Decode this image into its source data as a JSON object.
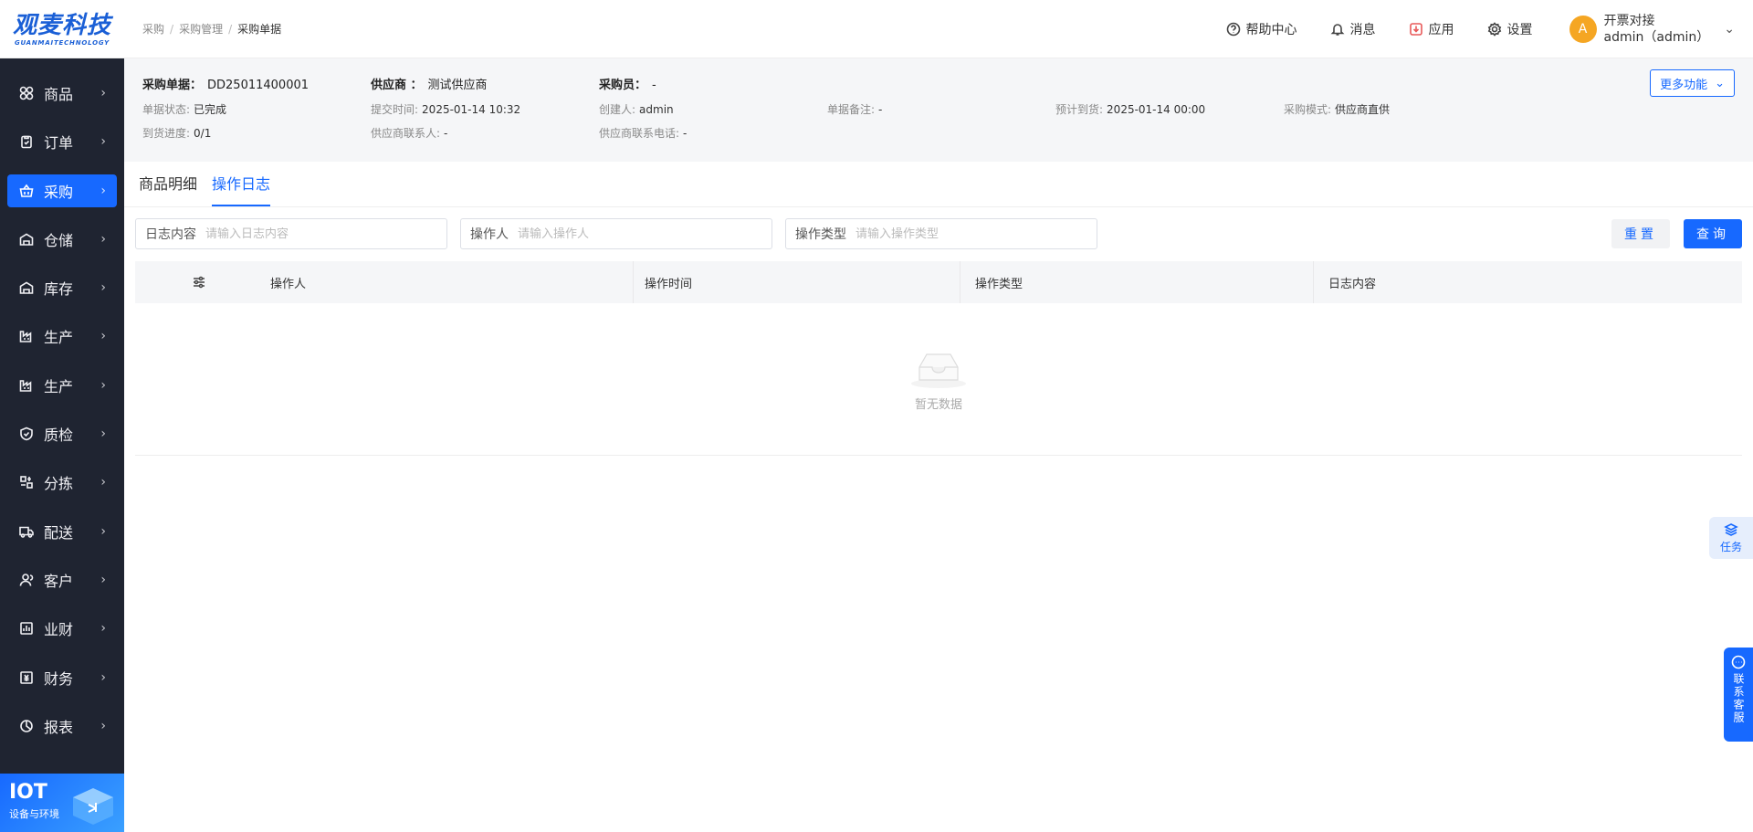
{
  "brand": {
    "cn": "观麦科技",
    "en": "GUANMAITECHNOLOGY",
    "color": "#1a5fd6"
  },
  "sidebar": {
    "items": [
      {
        "label": "商品",
        "icon": "grid-icon"
      },
      {
        "label": "订单",
        "icon": "clipboard-icon"
      },
      {
        "label": "采购",
        "icon": "basket-icon",
        "active": true
      },
      {
        "label": "仓储",
        "icon": "warehouse-icon"
      },
      {
        "label": "库存",
        "icon": "warehouse-icon"
      },
      {
        "label": "生产",
        "icon": "factory-icon"
      },
      {
        "label": "生产",
        "icon": "factory-icon"
      },
      {
        "label": "质检",
        "icon": "shield-icon"
      },
      {
        "label": "分拣",
        "icon": "sort-icon"
      },
      {
        "label": "配送",
        "icon": "truck-icon"
      },
      {
        "label": "客户",
        "icon": "user-icon"
      },
      {
        "label": "业财",
        "icon": "chart-icon"
      },
      {
        "label": "财务",
        "icon": "finance-icon"
      },
      {
        "label": "报表",
        "icon": "pie-icon"
      }
    ],
    "iot": {
      "title": "IOT",
      "subtitle": "设备与环境"
    }
  },
  "topbar": {
    "breadcrumb": [
      "采购",
      "采购管理",
      "采购单据"
    ],
    "actions": {
      "help": "帮助中心",
      "messages": "消息",
      "apps": "应用",
      "settings": "设置"
    },
    "user": {
      "avatar": "A",
      "company": "开票对接",
      "account": "admin（admin）"
    }
  },
  "info": {
    "order_no_label": "采购单据：",
    "order_no": "DD25011400001",
    "supplier_label": "供应商 ：",
    "supplier": "测试供应商",
    "buyer_label": "采购员：",
    "buyer": "-",
    "status_label": "单据状态:",
    "status": "已完成",
    "submit_time_label": "提交时间:",
    "submit_time": "2025-01-14 10:32",
    "creator_label": "创建人:",
    "creator": "admin",
    "remark_label": "单据备注:",
    "remark": "-",
    "eta_label": "预计到货:",
    "eta": "2025-01-14 00:00",
    "mode_label": "采购模式:",
    "mode": "供应商直供",
    "progress_label": "到货进度:",
    "progress": "0/1",
    "contact_label": "供应商联系人:",
    "contact": "-",
    "phone_label": "供应商联系电话:",
    "phone": "-",
    "more_button": "更多功能"
  },
  "tabs": [
    {
      "label": "商品明细",
      "active": false
    },
    {
      "label": "操作日志",
      "active": true
    }
  ],
  "filters": {
    "content": {
      "label": "日志内容",
      "placeholder": "请输入日志内容"
    },
    "operator": {
      "label": "操作人",
      "placeholder": "请输入操作人"
    },
    "type": {
      "label": "操作类型",
      "placeholder": "请输入操作类型"
    },
    "reset": "重置",
    "query": "查询"
  },
  "table": {
    "columns": [
      "操作人",
      "操作时间",
      "操作类型",
      "日志内容"
    ],
    "empty_text": "暂无数据"
  },
  "floats": {
    "task": "任务",
    "service": "联系客服"
  },
  "colors": {
    "primary": "#1769ff",
    "sidebar_bg": "#1f2431",
    "avatar": "#f5a623"
  }
}
